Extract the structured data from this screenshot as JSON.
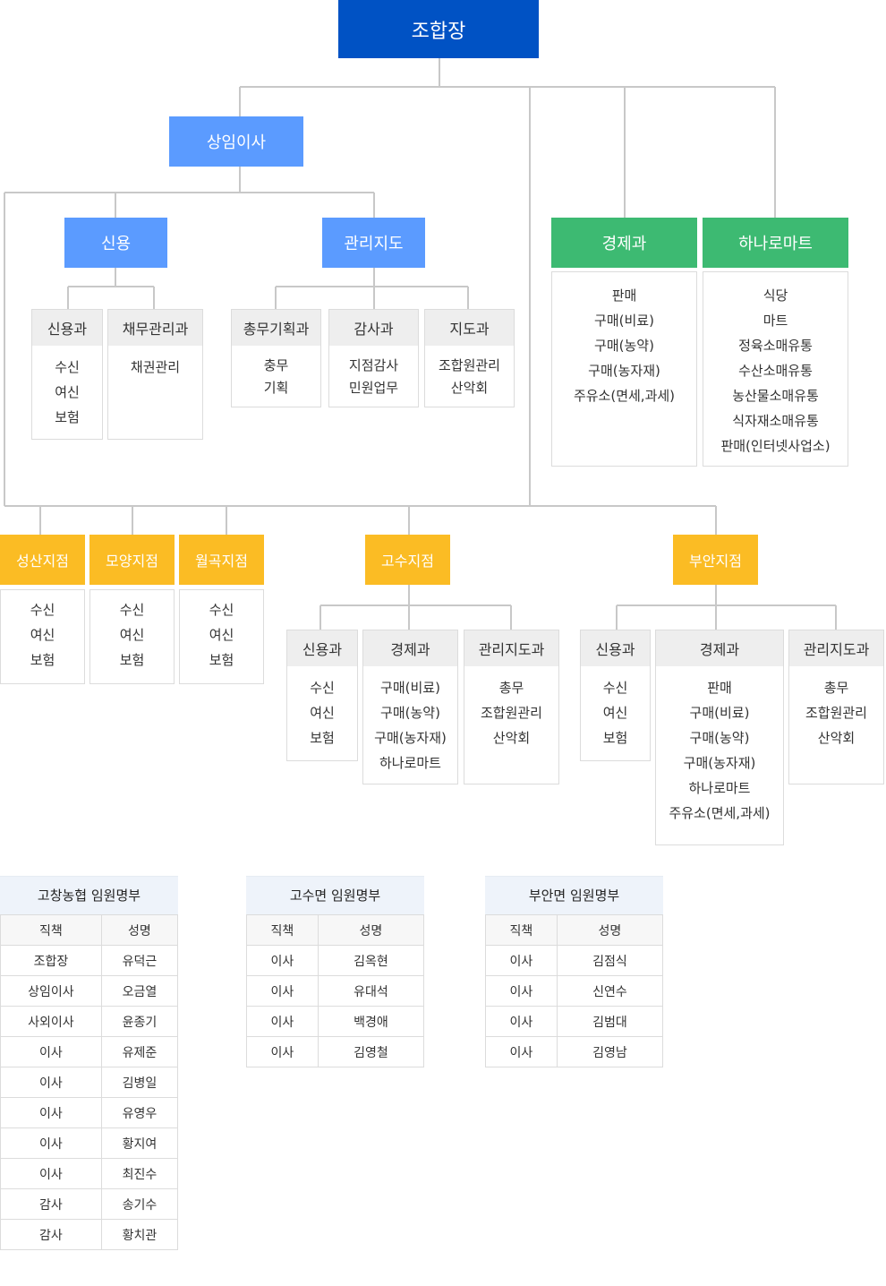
{
  "org": {
    "head": "조합장",
    "standing_director": "상임이사",
    "credit": "신용",
    "management": "관리지도",
    "economy": "경제과",
    "hanaro": "하나로마트",
    "credit_depts": [
      {
        "name": "신용과",
        "items": [
          "수신",
          "여신",
          "보험"
        ]
      },
      {
        "name": "채무관리과",
        "items": [
          "채권관리"
        ]
      }
    ],
    "management_depts": [
      {
        "name": "총무기획과",
        "items": [
          "충무",
          "기획"
        ]
      },
      {
        "name": "감사과",
        "items": [
          "지점감사",
          "민원업무"
        ]
      },
      {
        "name": "지도과",
        "items": [
          "조합원관리",
          "산악회"
        ]
      }
    ],
    "economy_items": [
      "판매",
      "구매(비료)",
      "구매(농약)",
      "구매(농자재)",
      "주유소(면세,과세)"
    ],
    "hanaro_items": [
      "식당",
      "마트",
      "정육소매유통",
      "수산소매유통",
      "농산물소매유통",
      "식자재소매유통",
      "판매(인터넷사업소)"
    ],
    "small_branches": [
      {
        "name": "성산지점",
        "items": [
          "수신",
          "여신",
          "보험"
        ]
      },
      {
        "name": "모양지점",
        "items": [
          "수신",
          "여신",
          "보험"
        ]
      },
      {
        "name": "월곡지점",
        "items": [
          "수신",
          "여신",
          "보험"
        ]
      }
    ],
    "gosu": {
      "name": "고수지점",
      "depts": [
        {
          "name": "신용과",
          "items": [
            "수신",
            "여신",
            "보험"
          ]
        },
        {
          "name": "경제과",
          "items": [
            "구매(비료)",
            "구매(농약)",
            "구매(농자재)",
            "하나로마트"
          ]
        },
        {
          "name": "관리지도과",
          "items": [
            "총무",
            "조합원관리",
            "산악회"
          ]
        }
      ]
    },
    "buan": {
      "name": "부안지점",
      "depts": [
        {
          "name": "신용과",
          "items": [
            "수신",
            "여신",
            "보험"
          ]
        },
        {
          "name": "경제과",
          "items": [
            "판매",
            "구매(비료)",
            "구매(농약)",
            "구매(농자재)",
            "하나로마트",
            "주유소(면세,과세)"
          ]
        },
        {
          "name": "관리지도과",
          "items": [
            "총무",
            "조합원관리",
            "산악회"
          ]
        }
      ]
    }
  },
  "colors": {
    "head": "#0052c4",
    "blue": "#5b9bff",
    "green": "#3dba72",
    "yellow": "#fbbc24",
    "line": "#c8c8c8"
  },
  "tables": [
    {
      "title": "고창농협 임원명부",
      "headers": [
        "직책",
        "성명"
      ],
      "rows": [
        [
          "조합장",
          "유덕근"
        ],
        [
          "상임이사",
          "오금열"
        ],
        [
          "사외이사",
          "윤종기"
        ],
        [
          "이사",
          "유제준"
        ],
        [
          "이사",
          "김병일"
        ],
        [
          "이사",
          "유영우"
        ],
        [
          "이사",
          "황지여"
        ],
        [
          "이사",
          "최진수"
        ],
        [
          "감사",
          "송기수"
        ],
        [
          "감사",
          "황치관"
        ]
      ]
    },
    {
      "title": "고수면 임원명부",
      "headers": [
        "직책",
        "성명"
      ],
      "rows": [
        [
          "이사",
          "김옥현"
        ],
        [
          "이사",
          "유대석"
        ],
        [
          "이사",
          "백경애"
        ],
        [
          "이사",
          "김영철"
        ]
      ]
    },
    {
      "title": "부안면 임원명부",
      "headers": [
        "직책",
        "성명"
      ],
      "rows": [
        [
          "이사",
          "김점식"
        ],
        [
          "이사",
          "신연수"
        ],
        [
          "이사",
          "김범대"
        ],
        [
          "이사",
          "김영남"
        ]
      ]
    }
  ]
}
